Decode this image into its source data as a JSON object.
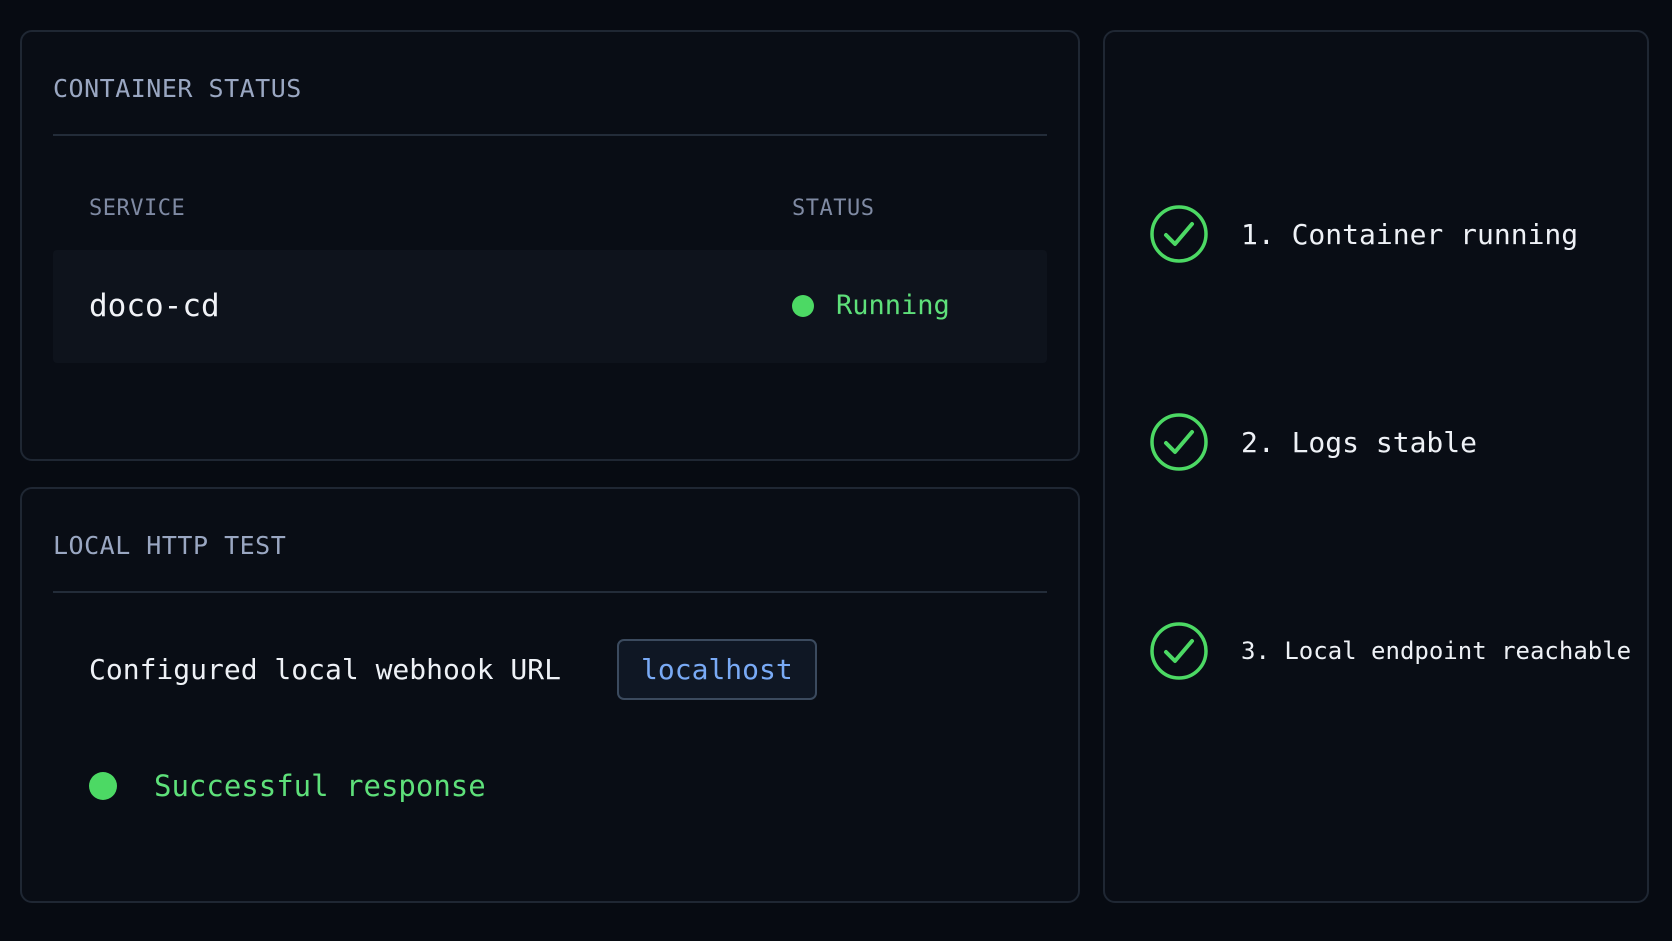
{
  "container_status": {
    "title": "CONTAINER STATUS",
    "columns": [
      "SERVICE",
      "STATUS"
    ],
    "rows": [
      {
        "service": "doco-cd",
        "status": "Running"
      }
    ]
  },
  "http_test": {
    "title": "LOCAL HTTP TEST",
    "url_label": "Configured local webhook URL",
    "url_value": "localhost",
    "result": "Successful response"
  },
  "checks": [
    {
      "label": "1. Container running",
      "icon": "check-circle-icon"
    },
    {
      "label": "2. Logs stable",
      "icon": "check-circle-icon"
    },
    {
      "label": "3. Local endpoint reachable",
      "icon": "check-circle-icon"
    }
  ],
  "colors": {
    "success": "#4cd964",
    "link": "#79aaf5",
    "background": "#070b12"
  }
}
